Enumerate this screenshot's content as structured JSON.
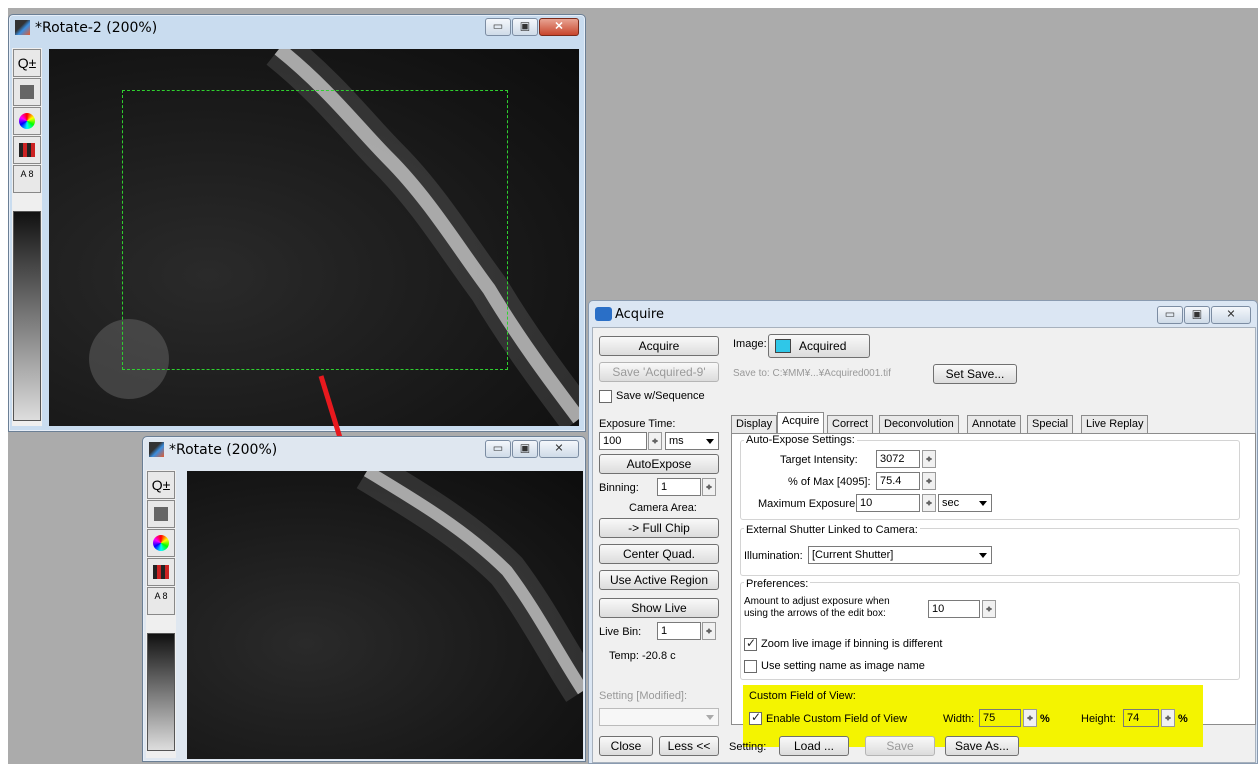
{
  "rotate2": {
    "title": "*Rotate-2 (200%)"
  },
  "rotate": {
    "title": "*Rotate (200%)"
  },
  "tools": {
    "zoom": "Q±",
    "scale": "A 8"
  },
  "acquire": {
    "title": "Acquire",
    "left": {
      "acquire_btn": "Acquire",
      "save_btn": "Save 'Acquired-9'",
      "save_seq": "Save w/Sequence",
      "exposure_label": "Exposure Time:",
      "exposure_value": "100",
      "exposure_unit": "ms",
      "autoexpose_btn": "AutoExpose",
      "binning_label": "Binning:",
      "binning_value": "1",
      "camera_area_label": "Camera Area:",
      "full_chip_btn": "-> Full Chip",
      "center_quad_btn": "Center Quad.",
      "use_active_btn": "Use Active Region",
      "show_live_btn": "Show Live",
      "live_bin_label": "Live Bin:",
      "live_bin_value": "1",
      "temp": "Temp: -20.8 c",
      "setting_label": "Setting [Modified]:"
    },
    "image": {
      "label": "Image:",
      "name": "Acquired",
      "save_to": "Save to: C:¥MM¥...¥Acquired001.tif",
      "set_save_btn": "Set Save..."
    },
    "tabs": [
      "Display",
      "Acquire",
      "Correct",
      "Deconvolution",
      "Annotate",
      "Special",
      "Live Replay"
    ],
    "auto_expose": {
      "legend": "Auto-Expose Settings:",
      "target_label": "Target Intensity:",
      "target_value": "3072",
      "pct_label": "% of Max [4095]:",
      "pct_value": "75.4",
      "max_label": "Maximum Exposure:",
      "max_value": "10",
      "max_unit": "sec"
    },
    "shutter": {
      "legend": "External Shutter Linked to Camera:",
      "illum_label": "Illumination:",
      "illum_value": "[Current Shutter]"
    },
    "prefs": {
      "legend": "Preferences:",
      "amount_line1": "Amount to adjust exposure when",
      "amount_line2": "using the arrows of the edit box:",
      "amount_value": "10",
      "zoom_live": "Zoom live image if binning is different",
      "use_setting": "Use setting name as image name"
    },
    "cfov": {
      "legend": "Custom Field of View:",
      "enable": "Enable Custom Field of View",
      "width_label": "Width:",
      "width_value": "75",
      "height_label": "Height:",
      "height_value": "74",
      "pct": "%"
    },
    "bottom": {
      "close_btn": "Close",
      "less_btn": "Less <<",
      "setting_label": "Setting:",
      "load_btn": "Load ...",
      "save_btn": "Save",
      "save_as_btn": "Save As..."
    }
  }
}
